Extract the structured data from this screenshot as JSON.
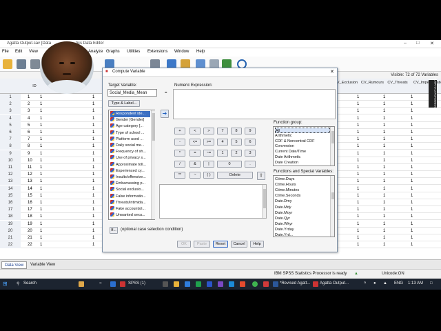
{
  "app": {
    "title": "Agatta Output.sav [Data",
    "title_rest": "tics Data Editor",
    "menus": [
      "File",
      "Edit",
      "View",
      "Analyze",
      "Graphs",
      "Utilities",
      "Extensions",
      "Window",
      "Help"
    ],
    "variables_visible": "Visible: 72 of 72 Variables"
  },
  "grid": {
    "headers": [
      "ID",
      "CV_Exclusion",
      "CV_Rumours",
      "CV_Threats",
      "CV_Impersonation"
    ],
    "rows": [
      {
        "n": "1",
        "id": "1",
        "a": "1",
        "b": "1",
        "c": "1",
        "d": "1",
        "e": "1"
      },
      {
        "n": "2",
        "id": "2",
        "a": "1",
        "b": "1",
        "c": "1",
        "d": "1",
        "e": "1"
      },
      {
        "n": "3",
        "id": "3",
        "a": "1",
        "b": "1",
        "c": "1",
        "d": "1",
        "e": "1"
      },
      {
        "n": "4",
        "id": "4",
        "a": "1",
        "b": "1",
        "c": "1",
        "d": "1",
        "e": "1"
      },
      {
        "n": "5",
        "id": "5",
        "a": "1",
        "b": "1",
        "c": "1",
        "d": "1",
        "e": "1"
      },
      {
        "n": "6",
        "id": "6",
        "a": "1",
        "b": "1",
        "c": "1",
        "d": "1",
        "e": "1"
      },
      {
        "n": "7",
        "id": "7",
        "a": "1",
        "b": "1",
        "c": "1",
        "d": "1",
        "e": "1"
      },
      {
        "n": "8",
        "id": "8",
        "a": "1",
        "b": "1",
        "c": "1",
        "d": "1",
        "e": "1"
      },
      {
        "n": "9",
        "id": "9",
        "a": "1",
        "b": "1",
        "c": "1",
        "d": "1",
        "e": "1"
      },
      {
        "n": "10",
        "id": "10",
        "a": "1",
        "b": "1",
        "c": "1",
        "d": "1",
        "e": "1"
      },
      {
        "n": "11",
        "id": "11",
        "a": "1",
        "b": "1",
        "c": "1",
        "d": "1",
        "e": "1"
      },
      {
        "n": "12",
        "id": "12",
        "a": "1",
        "b": "1",
        "c": "1",
        "d": "1",
        "e": "1"
      },
      {
        "n": "13",
        "id": "13",
        "a": "1",
        "b": "1",
        "c": "1",
        "d": "1",
        "e": "1"
      },
      {
        "n": "14",
        "id": "14",
        "a": "1",
        "b": "1",
        "c": "1",
        "d": "1",
        "e": "1"
      },
      {
        "n": "15",
        "id": "15",
        "a": "1",
        "b": "1",
        "c": "1",
        "d": "1",
        "e": "1"
      },
      {
        "n": "16",
        "id": "16",
        "a": "1",
        "b": "1",
        "c": "1",
        "d": "1",
        "e": "1"
      },
      {
        "n": "17",
        "id": "17",
        "a": "1",
        "b": "1",
        "c": "1",
        "d": "1",
        "e": "1"
      },
      {
        "n": "18",
        "id": "18",
        "a": "1",
        "b": "1",
        "c": "1",
        "d": "1",
        "e": "1"
      },
      {
        "n": "19",
        "id": "19",
        "a": "1",
        "b": "1",
        "c": "1",
        "d": "1",
        "e": "1"
      },
      {
        "n": "20",
        "id": "20",
        "a": "1",
        "b": "1",
        "c": "1",
        "d": "1",
        "e": "1"
      },
      {
        "n": "21",
        "id": "21",
        "a": "1",
        "b": "1",
        "c": "1",
        "d": "1",
        "e": "1"
      },
      {
        "n": "22",
        "id": "22",
        "a": "1",
        "b": "1",
        "c": "1",
        "d": "1",
        "e": "1"
      }
    ]
  },
  "tabs": {
    "data_view": "Data View",
    "variable_view": "Variable View"
  },
  "status": {
    "processor": "IBM SPSS Statistics Processor is ready",
    "unicode": "Unicode:ON"
  },
  "dialog": {
    "title": "Compute Variable",
    "target_label": "Target Variable:",
    "target_value": "Social_Media_Mean",
    "equals": "=",
    "numeric_expression_label": "Numeric Expression:",
    "type_label_button": "Type & Label...",
    "variables": [
      "Respondent ide...",
      "Gender [Gender]",
      "Age category [...",
      "Type of school ...",
      "Platform used ...",
      "Daily social me...",
      "Frequency of sh...",
      "Use of privacy s...",
      "Approximate toll...",
      "Experienced cy...",
      "Insults/offensive...",
      "Embarrassing p...",
      "Social exclusio...",
      "False informatio...",
      "Threats/intimida...",
      "Fake accounts/i...",
      "Unwanted sexu..."
    ],
    "keypad": [
      [
        "+",
        "<",
        ">",
        "7",
        "8",
        "9"
      ],
      [
        "-",
        "<=",
        ">=",
        "4",
        "5",
        "6"
      ],
      [
        "*",
        "=",
        "~=",
        "1",
        "2",
        "3"
      ],
      [
        "/",
        "&",
        "|",
        "0",
        "."
      ],
      [
        "**",
        "~",
        "( )",
        "Delete"
      ]
    ],
    "function_group_label": "Function group:",
    "function_groups": [
      "All",
      "Arithmetic",
      "CDF & Noncentral CDF",
      "Conversion",
      "Current Date/Time",
      "Date Arithmetic",
      "Date Creation"
    ],
    "functions_label": "Functions and Special Variables:",
    "functions": [
      "Ctime.Days",
      "Ctime.Hours",
      "Ctime.Minutes",
      "Ctime.Seconds",
      "Date.Dmy",
      "Date.Mdy",
      "Date.Moyr",
      "Date.Qyr",
      "Date.Wkyr",
      "Date.Yrday",
      "Date.Yrd..."
    ],
    "if_button": "If...",
    "if_hint": "(optional case selection condition)",
    "ok": "OK",
    "paste": "Paste",
    "reset": "Reset",
    "cancel": "Cancel",
    "help": "Help"
  },
  "taskbar": {
    "search": "Search",
    "spss": "SPSS (1)",
    "revised": "*Revised Agatt...",
    "agatta": "Agatta Output...",
    "lang": "ENG",
    "time": "1:13 AM"
  },
  "screencast": "SCREENCAST-O-MATIC"
}
